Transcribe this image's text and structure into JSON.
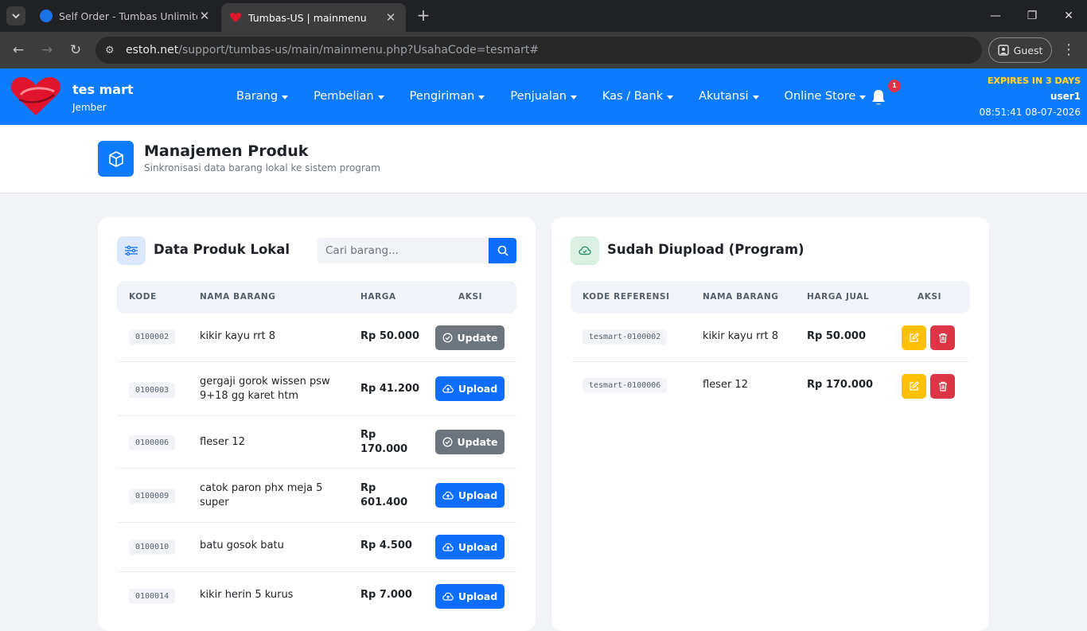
{
  "browser": {
    "tabs": [
      {
        "title": "Self Order - Tumbas Unlimited",
        "active": false
      },
      {
        "title": "Tumbas-US | mainmenu",
        "active": true
      }
    ],
    "url_host": "estoh.net",
    "url_path": "/support/tumbas-us/main/mainmenu.php?UsahaCode=tesmart#",
    "profile_label": "Guest"
  },
  "navbar": {
    "brand_name": "tes mart",
    "brand_city": "Jember",
    "menu": [
      "Barang",
      "Pembelian",
      "Pengiriman",
      "Penjualan",
      "Kas / Bank",
      "Akutansi",
      "Online Store"
    ],
    "notification_count": "1",
    "expires": "EXPIRES IN 3 DAYS",
    "user": "user1",
    "datetime": "08:51:41 08-07-2026"
  },
  "header": {
    "title": "Manajemen Produk",
    "subtitle": "Sinkronisasi data barang lokal ke sistem program"
  },
  "local": {
    "title": "Data Produk Lokal",
    "search_placeholder": "Cari barang...",
    "columns": [
      "KODE",
      "NAMA BARANG",
      "HARGA",
      "AKSI"
    ],
    "rows": [
      {
        "code": "0100002",
        "name": "kikir kayu rrt 8",
        "price": "Rp 50.000",
        "action": "Update"
      },
      {
        "code": "0100003",
        "name": "gergaji gorok wissen psw 9+18 gg karet htm",
        "price": "Rp 41.200",
        "action": "Upload"
      },
      {
        "code": "0100006",
        "name": "fleser 12",
        "price": "Rp 170.000",
        "action": "Update"
      },
      {
        "code": "0100009",
        "name": "catok paron phx meja 5 super",
        "price": "Rp 601.400",
        "action": "Upload"
      },
      {
        "code": "0100010",
        "name": "batu gosok batu",
        "price": "Rp 4.500",
        "action": "Upload"
      },
      {
        "code": "0100014",
        "name": "kikir herin 5 kurus",
        "price": "Rp 7.000",
        "action": "Upload"
      }
    ]
  },
  "uploaded": {
    "title": "Sudah Diupload (Program)",
    "columns": [
      "KODE REFERENSI",
      "NAMA BARANG",
      "HARGA JUAL",
      "AKSI"
    ],
    "rows": [
      {
        "ref": "tesmart-0100002",
        "name": "kikir kayu rrt 8",
        "price": "Rp 50.000"
      },
      {
        "ref": "tesmart-0100006",
        "name": "fleser 12",
        "price": "Rp 170.000"
      }
    ]
  },
  "colors": {
    "primary": "#0d7bfd",
    "update": "#6c757d",
    "upload": "#0d6efd",
    "edit": "#ffc107",
    "delete": "#dc3545",
    "expires": "#ffd43b"
  }
}
